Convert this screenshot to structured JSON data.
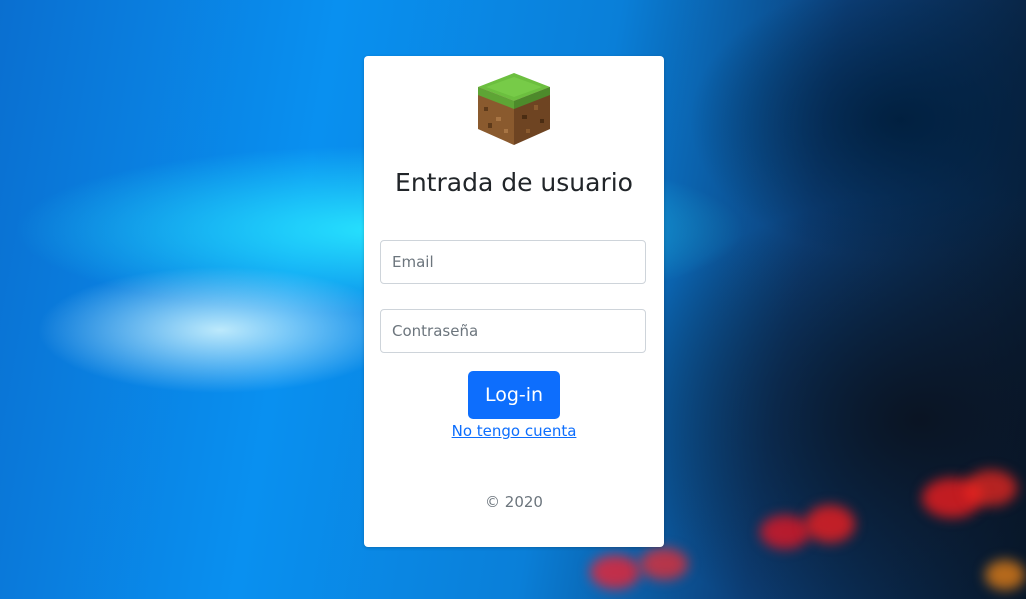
{
  "login": {
    "title": "Entrada de usuario",
    "email_placeholder": "Email",
    "password_placeholder": "Contraseña",
    "submit_label": "Log-in",
    "register_link": "No tengo cuenta",
    "footer": "© 2020"
  },
  "icons": {
    "logo": "grass-block-icon"
  },
  "colors": {
    "accent": "#0d6efd",
    "card_bg": "#ffffff",
    "text": "#212529",
    "muted": "#6c757d"
  }
}
